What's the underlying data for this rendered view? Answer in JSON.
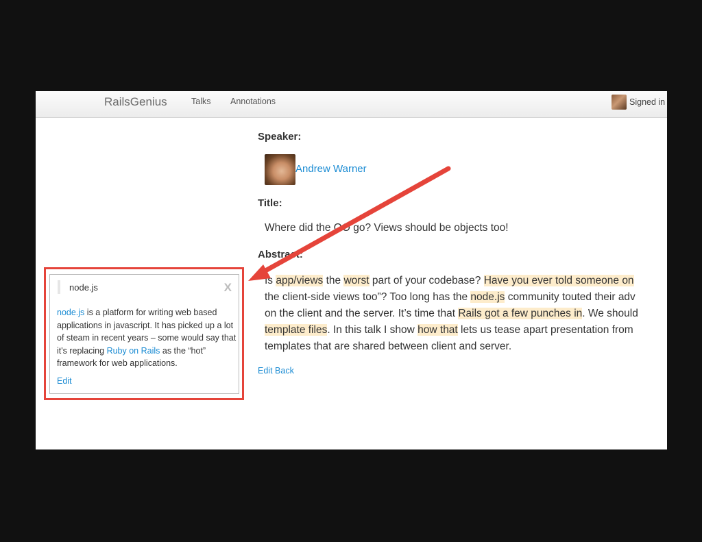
{
  "nav": {
    "brand": "RailsGenius",
    "links": [
      "Talks",
      "Annotations"
    ],
    "signed_in": "Signed in"
  },
  "speaker": {
    "label": "Speaker:",
    "name": "Andrew Warner"
  },
  "title": {
    "label": "Title:",
    "text": "Where did the OO go? Views should be objects too!"
  },
  "abstract": {
    "label": "Abstract:",
    "lines": [
      [
        [
          "Is ",
          false
        ],
        [
          "app/views",
          true
        ],
        [
          " the ",
          false
        ],
        [
          "worst",
          true
        ],
        [
          " part of your codebase? ",
          false
        ],
        [
          "Have you ever told someone on",
          true
        ]
      ],
      [
        [
          "the client-side views too”? Too long has the ",
          false
        ],
        [
          "node.js",
          true
        ],
        [
          " community touted their adv",
          false
        ]
      ],
      [
        [
          "on the client and the server. It’s time that ",
          false
        ],
        [
          "Rails got a few punches in",
          true
        ],
        [
          ". We should",
          false
        ]
      ],
      [
        [
          "template files",
          true
        ],
        [
          ". In this talk I show ",
          false
        ],
        [
          "how that",
          true
        ],
        [
          " lets us tease apart presentation from",
          false
        ]
      ],
      [
        [
          "templates that are shared between client and server.",
          false
        ]
      ]
    ]
  },
  "actions": {
    "edit": "Edit",
    "back": "Back"
  },
  "annotation": {
    "title": "node.js",
    "close": "X",
    "body": {
      "link1": "node.js",
      "text1": " is a platform for writing web based applications in javascript. It has picked up a lot of steam in recent years – some would say that it's replacing ",
      "link2": "Ruby on Rails",
      "text2": " as the “hot” framework for web applications."
    },
    "edit": "Edit"
  },
  "colors": {
    "link": "#1a8bd3",
    "highlight": "#fdeccb",
    "callout": "#e5443a"
  }
}
